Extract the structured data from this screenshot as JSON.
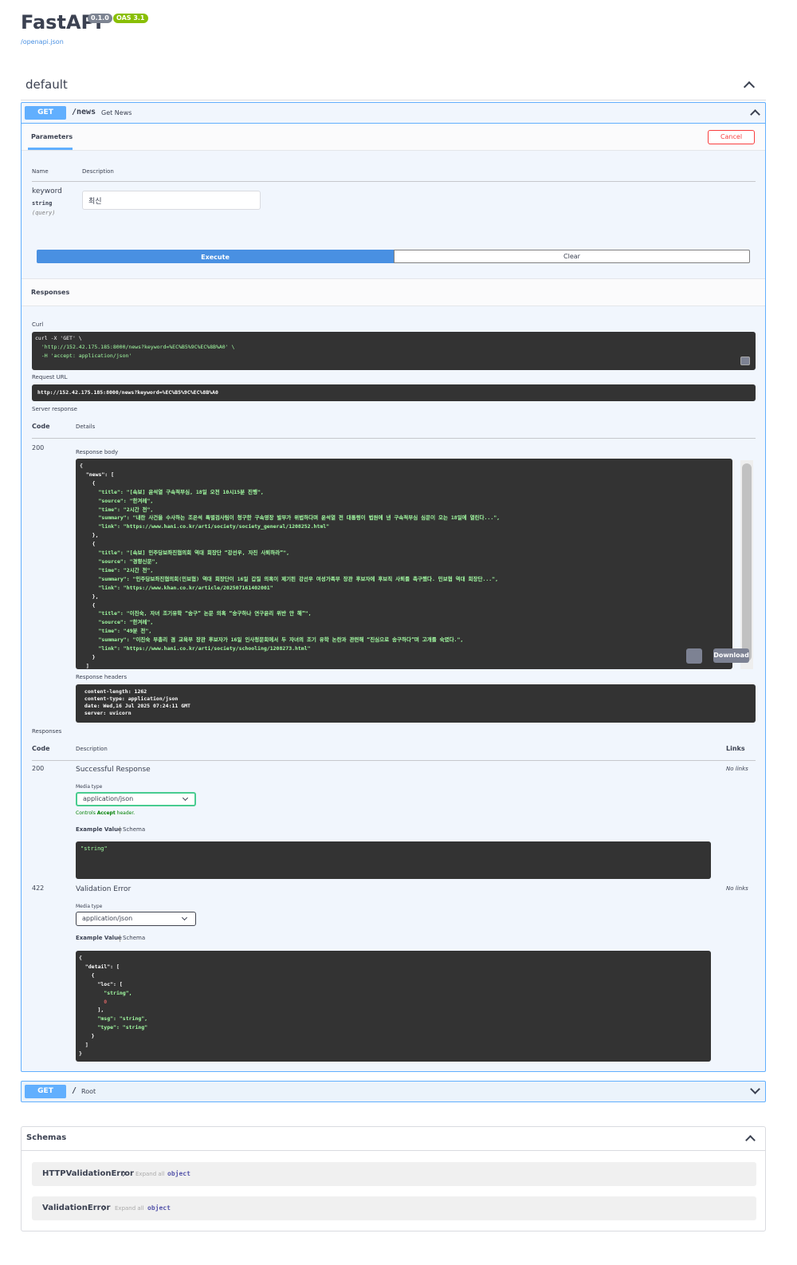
{
  "header": {
    "title": "FastAPI",
    "version_badge": "0.1.0",
    "oas_badge": "OAS 3.1",
    "openapi_link": "/openapi.json"
  },
  "tag": {
    "name": "default"
  },
  "operation": {
    "method": "GET",
    "path": "/news",
    "summary": "Get News",
    "params_tab": "Parameters",
    "cancel_label": "Cancel",
    "col_name": "Name",
    "col_description": "Description",
    "param": {
      "name": "keyword",
      "type": "string",
      "in": "(query)",
      "value": "최신"
    },
    "execute_label": "Execute",
    "clear_label": "Clear",
    "responses_title": "Responses",
    "curl_label": "Curl",
    "curl_lines": [
      "curl -X 'GET' \\",
      "  'http://152.42.175.185:8000/news?keyword=%EC%B5%9C%EC%8B%A0' \\",
      "  -H 'accept: application/json'"
    ],
    "request_url_label": "Request URL",
    "request_url": "http://152.42.175.185:8000/news?keyword=%EC%B5%9C%EC%8B%A0",
    "server_response_label": "Server response",
    "code_label": "Code",
    "details_label": "Details",
    "response_code": "200",
    "response_body_label": "Response body",
    "response_body_lines": [
      "{",
      "  \"news\": [",
      "    {",
      "      \"title\": \"[속보] 윤석열 구속적부심, 18일 오전 10시15분 진행\",",
      "      \"source\": \"한겨레\",",
      "      \"time\": \"2시간 전\",",
      "      \"summary\": \"내란 사건을 수사하는 조은석 특별검사팀이 청구한 구속영장 발부가 위법하다며 윤석열 전 대통령이 법원에 낸 구속적부심 심문이 오는 18일에 열린다...\",",
      "      \"link\": \"https://www.hani.co.kr/arti/society/society_general/1208252.html\"",
      "    },",
      "    {",
      "      \"title\": \"[속보] 민주당보좌진협의회 역대 회장단 “강선우, 자진 사퇴하라”\",",
      "      \"source\": \"경향신문\",",
      "      \"time\": \"2시간 전\",",
      "      \"summary\": \"민주당보좌진협의회(민보협) 역대 회장단이 16일 갑질 의혹이 제기된 강선우 여성가족부 장관 후보자에 후보직 사퇴를 촉구했다. 민보협 역대 회장단...\",",
      "      \"link\": \"https://www.khan.co.kr/article/202507161402001\"",
      "    },",
      "    {",
      "      \"title\": \"이진숙, 자녀 조기유학 “송구” 논문 의혹 “송구하나 연구윤리 위반 안 해”\",",
      "      \"source\": \"한겨레\",",
      "      \"time\": \"49분 전\",",
      "      \"summary\": \"이진숙 부총리 겸 교육부 장관 후보자가 16일 인사청문회에서 두 자녀의 조기 유학 논란과 관련해 “진심으로 송구하다”며 고개를 숙였다.\",",
      "      \"link\": \"https://www.hani.co.kr/arti/society/schooling/1208273.html\"",
      "    }",
      "  ]"
    ],
    "download_label": "Download",
    "response_headers_label": "Response headers",
    "response_headers_lines": [
      " content-length: 1262 ",
      " content-type: application/json ",
      " date: Wed,16 Jul 2025 07:24:11 GMT ",
      " server: uvicorn "
    ],
    "responses_label": "Responses",
    "description_label": "Description",
    "links_label": "Links",
    "resp200": {
      "code": "200",
      "description": "Successful Response",
      "no_links": "No links",
      "media_type_label": "Media type",
      "media_type": "application/json",
      "controls_note_prefix": "Controls ",
      "controls_note_bold": "Accept",
      "controls_note_suffix": " header.",
      "example_tab": "Example Value",
      "schema_tab": "Schema",
      "example": "\"string\""
    },
    "resp422": {
      "code": "422",
      "description": "Validation Error",
      "no_links": "No links",
      "media_type_label": "Media type",
      "media_type": "application/json",
      "example_tab": "Example Value",
      "schema_tab": "Schema",
      "example_lines": [
        "{",
        "  \"detail\": [",
        "    {",
        "      \"loc\": [",
        "        \"string\",",
        "        0",
        "      ],",
        "      \"msg\": \"string\",",
        "      \"type\": \"string\"",
        "    }",
        "  ]",
        "}"
      ]
    }
  },
  "root_operation": {
    "method": "GET",
    "path": "/",
    "summary": "Root"
  },
  "schemas": {
    "title": "Schemas",
    "items": [
      {
        "name": "HTTPValidationError",
        "expand": "Expand all",
        "type": "object"
      },
      {
        "name": "ValidationError",
        "expand": "Expand all",
        "type": "object"
      }
    ]
  },
  "colors": {
    "get": "#61affe",
    "execute": "#4990e2",
    "cancel": "#f93e3e",
    "valid": "#49cc90"
  }
}
